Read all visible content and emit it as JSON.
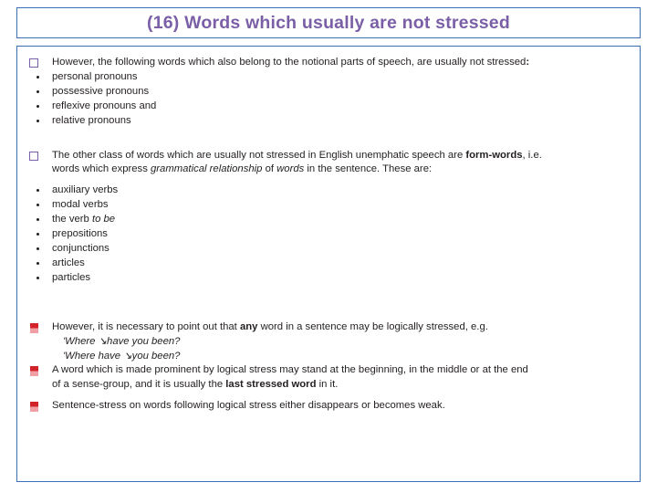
{
  "slide": {
    "title": "(16) Words which usually are not stressed",
    "blocks": [
      {
        "id": "block1",
        "lead": {
          "bullet": "square-outline",
          "parts": [
            {
              "text": "However, the following words which also belong to the notional parts of speech, are usually not stressed",
              "style": "normal"
            },
            {
              "text": ":",
              "style": "bold"
            }
          ]
        },
        "items": [
          "personal pronouns",
          "possessive pronouns",
          "reflexive pronouns and",
          "relative pronouns"
        ]
      },
      {
        "id": "block2",
        "lead": {
          "bullet": "square-outline",
          "parts": [
            {
              "text": "The other class of words which are usually not stressed in English unemphatic speech are ",
              "style": "normal"
            },
            {
              "text": "form-words",
              "style": "bold"
            },
            {
              "text": ", i.e.",
              "style": "normal"
            }
          ]
        },
        "lead_continuation": [
          {
            "text": "words which express ",
            "style": "normal"
          },
          {
            "text": "grammatical relationship",
            "style": "italic"
          },
          {
            "text": " of ",
            "style": "normal"
          },
          {
            "text": "words",
            "style": "italic"
          },
          {
            "text": " in the sentence.  These are:",
            "style": "normal"
          }
        ],
        "items": [
          "auxiliary verbs",
          "modal verbs",
          "the verb to be",
          "prepositions",
          "conjunctions",
          "articles",
          "particles"
        ],
        "item_italic_tail": {
          "index": 2,
          "plain": "the verb ",
          "italic": "to be"
        }
      },
      {
        "id": "block3",
        "paragraphs": [
          {
            "bullet": "flag",
            "parts": [
              {
                "text": "However, it is necessary to point out that ",
                "style": "normal"
              },
              {
                "text": "any",
                "style": "bold"
              },
              {
                "text": " word in a sentence may be logically stressed, e.g.",
                "style": "normal"
              }
            ],
            "examples": [
              "'Where ↘have you been?",
              " 'Where have ↘you been?"
            ]
          },
          {
            "bullet": "flag",
            "parts": [
              {
                "text": "A word which is made prominent by logical stress may stand at the beginning, in the middle or at the end",
                "style": "normal"
              }
            ],
            "continuation": [
              {
                "text": "of a sense-group, and it is usually the ",
                "style": "normal"
              },
              {
                "text": "last stressed word",
                "style": "bold"
              },
              {
                "text": " in it.",
                "style": "normal"
              }
            ]
          },
          {
            "bullet": "flag",
            "parts": [
              {
                "text": "Sentence-stress on words following logical stress either disappears or becomes weak.",
                "style": "normal"
              }
            ]
          }
        ]
      }
    ]
  },
  "colors": {
    "title": "#7a5fa6",
    "border": "#3b6fb6",
    "bullet_purple": "#7a5fa6",
    "flag_red": "#d2232a",
    "text": "#231f20"
  }
}
